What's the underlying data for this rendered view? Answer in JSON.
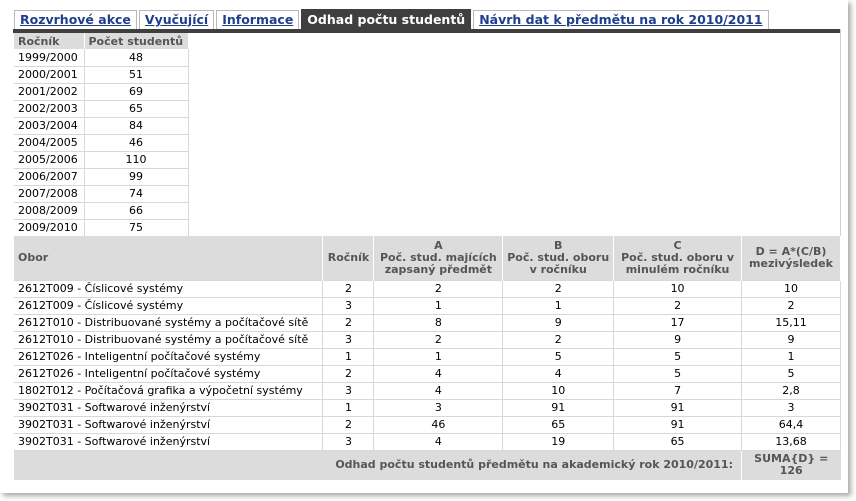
{
  "tabs": [
    {
      "label": "Rozvrhové akce",
      "active": false
    },
    {
      "label": "Vyučující",
      "active": false
    },
    {
      "label": "Informace",
      "active": false
    },
    {
      "label": "Odhad počtu studentů",
      "active": true
    },
    {
      "label": "Návrh dat k předmětu na rok 2010/2011",
      "active": false
    }
  ],
  "years_table": {
    "headers": [
      "Ročník",
      "Počet studentů"
    ],
    "rows": [
      [
        "1999/2000",
        "48"
      ],
      [
        "2000/2001",
        "51"
      ],
      [
        "2001/2002",
        "69"
      ],
      [
        "2002/2003",
        "65"
      ],
      [
        "2003/2004",
        "84"
      ],
      [
        "2004/2005",
        "46"
      ],
      [
        "2005/2006",
        "110"
      ],
      [
        "2006/2007",
        "99"
      ],
      [
        "2007/2008",
        "74"
      ],
      [
        "2008/2009",
        "66"
      ],
      [
        "2009/2010",
        "75"
      ]
    ]
  },
  "obor_table": {
    "headers": {
      "obor": "Obor",
      "rocnik": "Ročník",
      "a_letter": "A",
      "a_text": "Poč. stud. majících zapsaný předmět",
      "b_letter": "B",
      "b_text": "Poč. stud. oboru v ročníku",
      "c_letter": "C",
      "c_text": "Poč. stud. oboru v minulém ročníku",
      "d_formula": "D = A*(C/B)",
      "d_text": "mezivýsledek"
    },
    "rows": [
      [
        "2612T009 - Číslicové systémy",
        "2",
        "2",
        "2",
        "10",
        "10"
      ],
      [
        "2612T009 - Číslicové systémy",
        "3",
        "1",
        "1",
        "2",
        "2"
      ],
      [
        "2612T010 - Distribuované systémy a počítačové sítě",
        "2",
        "8",
        "9",
        "17",
        "15,11"
      ],
      [
        "2612T010 - Distribuované systémy a počítačové sítě",
        "3",
        "2",
        "2",
        "9",
        "9"
      ],
      [
        "2612T026 - Inteligentní počítačové systémy",
        "1",
        "1",
        "5",
        "5",
        "1"
      ],
      [
        "2612T026 - Inteligentní počítačové systémy",
        "2",
        "4",
        "4",
        "5",
        "5"
      ],
      [
        "1802T012 - Počítačová grafika a výpočetní systémy",
        "3",
        "4",
        "10",
        "7",
        "2,8"
      ],
      [
        "3902T031 - Softwarové inženýrství",
        "1",
        "3",
        "91",
        "91",
        "3"
      ],
      [
        "3902T031 - Softwarové inženýrství",
        "2",
        "46",
        "65",
        "91",
        "64,4"
      ],
      [
        "3902T031 - Softwarové inženýrství",
        "3",
        "4",
        "19",
        "65",
        "13,68"
      ]
    ],
    "footer_label": "Odhad počtu studentů předmětu na akademický rok 2010/2011:",
    "footer_sum_label": "SUMA{D} =",
    "footer_sum_value": "126"
  }
}
